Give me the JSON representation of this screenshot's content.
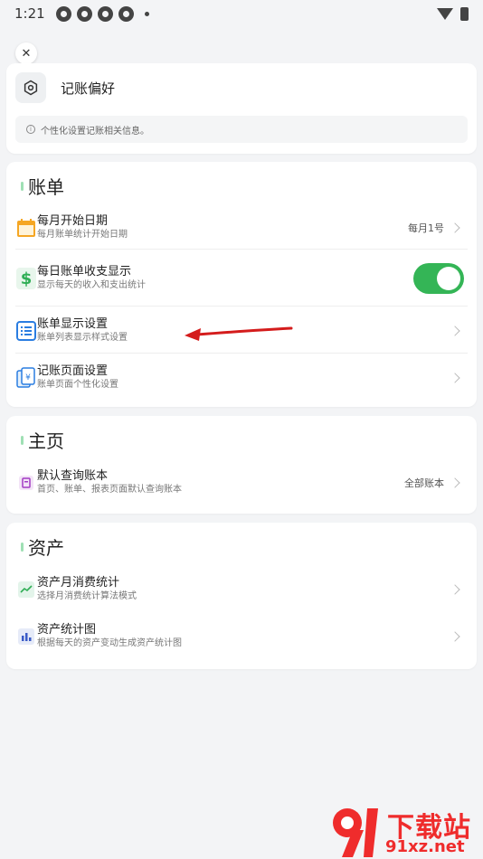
{
  "status_bar": {
    "time": "1:21"
  },
  "preferences": {
    "title": "记账偏好",
    "info": "个性化设置记账相关信息。"
  },
  "bill_section": {
    "title": "账单",
    "items": [
      {
        "title": "每月开始日期",
        "subtitle": "每月账单统计开始日期",
        "value": "每月1号",
        "icon": "calendar-icon"
      },
      {
        "title": "每日账单收支显示",
        "subtitle": "显示每天的收入和支出统计",
        "toggle": true,
        "icon": "dollar-icon"
      },
      {
        "title": "账单显示设置",
        "subtitle": "账单列表显示样式设置",
        "icon": "list-icon"
      },
      {
        "title": "记账页面设置",
        "subtitle": "账单页面个性化设置",
        "icon": "receipt-icon"
      }
    ]
  },
  "home_section": {
    "title": "主页",
    "items": [
      {
        "title": "默认查询账本",
        "subtitle": "首页、账单、报表页面默认查询账本",
        "value": "全部账本",
        "icon": "ledger-icon"
      }
    ]
  },
  "asset_section": {
    "title": "资产",
    "items": [
      {
        "title": "资产月消费统计",
        "subtitle": "选择月消费统计算法模式",
        "icon": "trend-icon"
      },
      {
        "title": "资产统计图",
        "subtitle": "根据每天的资产变动生成资产统计图",
        "icon": "bar-chart-icon"
      }
    ]
  },
  "watermark": {
    "top": "下载站",
    "bottom": "91xz.net"
  },
  "colors": {
    "toggle_on": "#34b556",
    "arrow": "#d41c1c",
    "calendar": "#f5a623",
    "dollar": "#2fae55",
    "list": "#2a7de1",
    "watermark": "#ef2c2c"
  }
}
